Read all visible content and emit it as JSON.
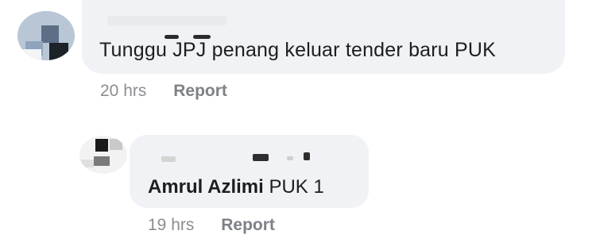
{
  "comments": [
    {
      "author": "",
      "text": "Tunggu JPJ penang keluar tender baru PUK",
      "time": "20 hrs",
      "report_label": "Report"
    },
    {
      "author": "",
      "mention": "Amrul Azlimi",
      "text": " PUK 1",
      "time": "19 hrs",
      "report_label": "Report"
    }
  ],
  "colors": {
    "bubble": "#f0f2f5",
    "meta_text": "#8a8d91",
    "body_text": "#1c1e21"
  }
}
